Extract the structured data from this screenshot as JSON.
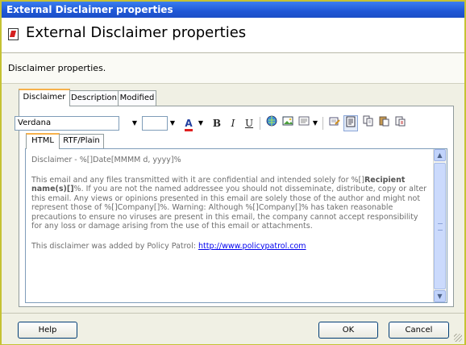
{
  "window": {
    "title": "External Disclaimer properties"
  },
  "header": {
    "title": "External Disclaimer properties",
    "icon": "disclaimer-icon"
  },
  "subtitle": "Disclaimer properties.",
  "tabs": [
    {
      "label": "Disclaimer",
      "active": true
    },
    {
      "label": "Description"
    },
    {
      "label": "Modified"
    }
  ],
  "toolbar": {
    "font": "Verdana",
    "size": "",
    "font_color_letter": "A",
    "bold": "B",
    "italic": "I",
    "underline": "U"
  },
  "editor_tabs": [
    {
      "label": "HTML",
      "active": true
    },
    {
      "label": "RTF/Plain"
    }
  ],
  "body": {
    "line1": "Disclaimer - %[]Date[MMMM d, yyyy]%",
    "p2_start": "This email and any files transmitted with it are confidential and intended solely for %[]",
    "p2_bold": "Recipient name(s)[]",
    "p2_end": "%. If you are not the named addressee you should not disseminate, distribute, copy or alter this email. Any views or opinions presented in this email are solely those of the author and might not represent those of %[]Company[]%. Warning: Although %[]Company[]% has taken reasonable precautions to ensure no viruses are present in this email, the company cannot accept responsibility for any loss or damage arising from the use of this email or attachments.",
    "p3_text": "This disclaimer was added by Policy Patrol: ",
    "p3_link": "http://www.policypatrol.com"
  },
  "buttons": {
    "help": "Help",
    "ok": "OK",
    "cancel": "Cancel"
  },
  "colors": {
    "title_bar": "#1f57d6",
    "tab_highlight": "#f7b14b",
    "font_color_underline": "#e02020"
  }
}
